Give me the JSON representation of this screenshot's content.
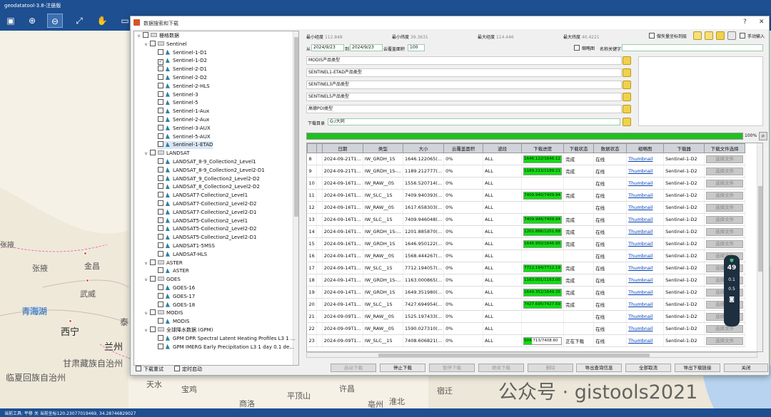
{
  "app": {
    "title": "geodatatool-3.8-注册版"
  },
  "toolbar": {
    "icons": [
      "save-icon",
      "zoom-in-icon",
      "zoom-out-icon",
      "zoom-extent-icon",
      "pan-icon",
      "ruler-icon"
    ]
  },
  "map": {
    "cities": [
      "张掖",
      "金昌",
      "武威",
      "青海湖",
      "西宁",
      "兰州",
      "甘肃藏族自治州",
      "临夏回族自治州",
      "天水",
      "宝鸡",
      "平顶山",
      "许昌",
      "商洛",
      "亳州",
      "淮北",
      "宿迁",
      "泰"
    ]
  },
  "dialog": {
    "title": "数据搜索和下载",
    "help": "?",
    "close": "✕"
  },
  "tree": {
    "root": "栅格数据",
    "groups": [
      {
        "label": "Sentinel",
        "items": [
          "Sentinel-1-D1",
          "Sentinel-1-D2",
          "Sentinel-2-D1",
          "Sentinel-2-D2",
          "Sentinel-2-HLS",
          "Sentinel-3",
          "Sentinel-5",
          "Sentinel-1-Aux",
          "Sentinel-2-Aux",
          "Sentinel-3-AUX",
          "Sentinel-5-AUX",
          "Sentinel-1-ETAD"
        ]
      },
      {
        "label": "LANDSAT",
        "items": [
          "LANDSAT_8-9_Collection2_Level1",
          "LANDSAT_8-9_Collection2_Level2-D1",
          "LANDSAT_9_Collection2_Level2-D2",
          "LANDSAT_8_Collection2_Level2-D2",
          "LANDSAT7-Collection2_Level1",
          "LANDSAT7-Collection2_Level2-D2",
          "LANDSAT7-Collection2_Level2-D1",
          "LANDSAT5-Collection2_Level1",
          "LANDSAT5-Collection2_Level2-D2",
          "LANDSAT5-Collection2_Level2-D1",
          "LANDSAT1-5MSS",
          "LANDSAT-HLS"
        ]
      },
      {
        "label": "ASTER",
        "items": [
          "ASTER"
        ]
      },
      {
        "label": "GOES",
        "items": [
          "GOES-16",
          "GOES-17",
          "GOES-18"
        ]
      },
      {
        "label": "MODIS",
        "items": [
          "MODIS"
        ]
      },
      {
        "label": "全球降水数据 (GPM)",
        "items": [
          "GPM DPR Spectral Latent Heating Profiles L3 1 ...",
          "GPM IMERG Early Precipitation L3 1 day 0.1 de..."
        ]
      }
    ],
    "checked_item": "Sentinel-1-D2",
    "selected_item": "Sentinel-1-ETAD"
  },
  "bounds": {
    "minlon_label": "最小经度",
    "minlon": "112.848",
    "minlat_label": "最小纬度",
    "minlat": "39.3631",
    "maxlon_label": "最大经度",
    "maxlon": "114.446",
    "maxlat_label": "最大纬度",
    "maxlat": "40.4221",
    "layer_label": "做矢量坐标到层",
    "manual_label": "手动输入"
  },
  "dates": {
    "from_label": "从",
    "from": "2024/9/23",
    "to_label": "到",
    "to": "2024/9/23",
    "cloud_label": "云覆盖面积",
    "cloud": "100",
    "thumb_label": "缩略图",
    "keyword_label": "名称关键字"
  },
  "product_types": [
    "MODIS产品类型",
    "SENTINEL1-ETAD产品类型",
    "SENTINEL3产品类型",
    "SENTINEL5产品类型",
    "高德POI类型"
  ],
  "download_dir": {
    "label": "下载目录",
    "value": "G:/大同"
  },
  "overall_progress": {
    "value": 100,
    "label": "100%"
  },
  "grid": {
    "headers": [
      "日期",
      "类型",
      "大小",
      "云覆盖面积",
      "波段",
      "下载进度",
      "下载状态",
      "数据状态",
      "缩略图",
      "下载器",
      "下载文件选择"
    ],
    "rows": [
      {
        "n": "8",
        "date": "2024-09-21T1...",
        "type": "IW_GRDH_1S",
        "size": "1646.122065(...",
        "cloud": "0%",
        "band": "ALL",
        "prog": 1.0,
        "ptxt": "1646.122/1646.12",
        "state": "完成",
        "data": "在线",
        "thumb": "Thumbnail",
        "dl": "Sentinel-1-D2",
        "pick": "选择文件"
      },
      {
        "n": "9",
        "date": "2024-09-21T1...",
        "type": "IW_GRDH_1S-...",
        "size": "1189.212777(...",
        "cloud": "0%",
        "band": "ALL",
        "prog": 1.0,
        "ptxt": "1189.213/1189.21",
        "state": "完成",
        "data": "在线",
        "thumb": "Thumbnail",
        "dl": "Sentinel-1-D2",
        "pick": "选择文件"
      },
      {
        "n": "10",
        "date": "2024-09-16T1...",
        "type": "IW_RAW__0S",
        "size": "1556.520714(...",
        "cloud": "0%",
        "band": "ALL",
        "prog": 0,
        "ptxt": "",
        "state": "",
        "data": "在线",
        "thumb": "Thumbnail",
        "dl": "Sentinel-1-D2",
        "pick": "选择文件"
      },
      {
        "n": "11",
        "date": "2024-09-16T1...",
        "type": "IW_SLC__1S",
        "size": "7409.940393(...",
        "cloud": "0%",
        "band": "ALL",
        "prog": 1.0,
        "ptxt": "7409.940/7409.94",
        "state": "完成",
        "data": "在线",
        "thumb": "Thumbnail",
        "dl": "Sentinel-1-D2",
        "pick": "选择文件"
      },
      {
        "n": "12",
        "date": "2024-09-16T1...",
        "type": "IW_RAW__0S",
        "size": "1617.658303(...",
        "cloud": "0%",
        "band": "ALL",
        "prog": 0,
        "ptxt": "",
        "state": "",
        "data": "在线",
        "thumb": "Thumbnail",
        "dl": "Sentinel-1-D2",
        "pick": "选择文件"
      },
      {
        "n": "13",
        "date": "2024-09-16T1...",
        "type": "IW_SLC__1S",
        "size": "7409.946048(...",
        "cloud": "0%",
        "band": "ALL",
        "prog": 1.0,
        "ptxt": "7409.946/7409.94",
        "state": "完成",
        "data": "在线",
        "thumb": "Thumbnail",
        "dl": "Sentinel-1-D2",
        "pick": "选择文件"
      },
      {
        "n": "14",
        "date": "2024-09-16T1...",
        "type": "IW_GRDH_1S-...",
        "size": "1201.885870(...",
        "cloud": "0%",
        "band": "ALL",
        "prog": 1.0,
        "ptxt": "1201.886/1201.88",
        "state": "完成",
        "data": "在线",
        "thumb": "Thumbnail",
        "dl": "Sentinel-1-D2",
        "pick": "选择文件"
      },
      {
        "n": "15",
        "date": "2024-09-16T1...",
        "type": "IW_GRDH_1S",
        "size": "1646.950122(...",
        "cloud": "0%",
        "band": "ALL",
        "prog": 1.0,
        "ptxt": "1646.950/1646.95",
        "state": "完成",
        "data": "在线",
        "thumb": "Thumbnail",
        "dl": "Sentinel-1-D2",
        "pick": "选择文件"
      },
      {
        "n": "16",
        "date": "2024-09-14T1...",
        "type": "IW_RAW__0S",
        "size": "1568.444267(...",
        "cloud": "0%",
        "band": "ALL",
        "prog": 0,
        "ptxt": "",
        "state": "",
        "data": "在线",
        "thumb": "Thumbnail",
        "dl": "Sentinel-1-D2",
        "pick": "选择文件"
      },
      {
        "n": "17",
        "date": "2024-09-14T1...",
        "type": "IW_SLC__1S",
        "size": "7712.194057(...",
        "cloud": "0%",
        "band": "ALL",
        "prog": 1.0,
        "ptxt": "7712.194/7712.19",
        "state": "完成",
        "data": "在线",
        "thumb": "Thumbnail",
        "dl": "Sentinel-1-D2",
        "pick": "选择文件"
      },
      {
        "n": "18",
        "date": "2024-09-14T1...",
        "type": "IW_GRDH_1S-...",
        "size": "1163.000865(...",
        "cloud": "0%",
        "band": "ALL",
        "prog": 1.0,
        "ptxt": "1163.001/1163.00",
        "state": "完成",
        "data": "在线",
        "thumb": "Thumbnail",
        "dl": "Sentinel-1-D2",
        "pick": "选择文件"
      },
      {
        "n": "19",
        "date": "2024-09-14T1...",
        "type": "IW_GRDH_1S",
        "size": "1649.351980(...",
        "cloud": "0%",
        "band": "ALL",
        "prog": 1.0,
        "ptxt": "1649.352/1649.35",
        "state": "完成",
        "data": "在线",
        "thumb": "Thumbnail",
        "dl": "Sentinel-1-D2",
        "pick": "选择文件"
      },
      {
        "n": "20",
        "date": "2024-09-14T1...",
        "type": "IW_SLC__1S",
        "size": "7427.694954(...",
        "cloud": "0%",
        "band": "ALL",
        "prog": 1.0,
        "ptxt": "7427.695/7427.69",
        "state": "完成",
        "data": "在线",
        "thumb": "Thumbnail",
        "dl": "Sentinel-1-D2",
        "pick": "选择文件"
      },
      {
        "n": "21",
        "date": "2024-09-09T1...",
        "type": "IW_RAW__0S",
        "size": "1525.197433(...",
        "cloud": "0%",
        "band": "ALL",
        "prog": 0,
        "ptxt": "",
        "state": "",
        "data": "在线",
        "thumb": "Thumbnail",
        "dl": "Sentinel-1-D2",
        "pick": "选择文件"
      },
      {
        "n": "22",
        "date": "2024-09-09T1...",
        "type": "IW_RAW__0S",
        "size": "1590.027310(...",
        "cloud": "0%",
        "band": "ALL",
        "prog": 0,
        "ptxt": "",
        "state": "",
        "data": "在线",
        "thumb": "Thumbnail",
        "dl": "Sentinel-1-D2",
        "pick": "选择文件"
      },
      {
        "n": "23",
        "date": "2024-09-09T1...",
        "type": "IW_SLC__1S",
        "size": "7408.606821(...",
        "cloud": "0%",
        "band": "ALL",
        "prog": 0.2,
        "ptxt": "504.713/7408.60",
        "state": "正在下载",
        "data": "在线",
        "thumb": "Thumbnail",
        "dl": "Sentinel-1-D2",
        "pick": "选择文件"
      }
    ]
  },
  "bottom": {
    "retry": "下载重试",
    "timer": "定时启动",
    "start": "启动下载",
    "stop": "停止下载",
    "pause": "暂停下载",
    "resume": "继续下载",
    "delete": "删除",
    "export_info": "导出查询信息",
    "cancel_all": "全部取消",
    "export_links": "导出下载链接",
    "close": "关闭"
  },
  "status": {
    "text": "当前工具: 平移 关  当前坐标120.23077019469, 34.28746829027"
  },
  "widget": {
    "score": "49",
    "up": "0.1",
    "down": "0.5"
  },
  "watermark": "公众号 · gistools2021",
  "colors": {
    "accent": "#1d4f91",
    "progress": "#11dd11"
  }
}
